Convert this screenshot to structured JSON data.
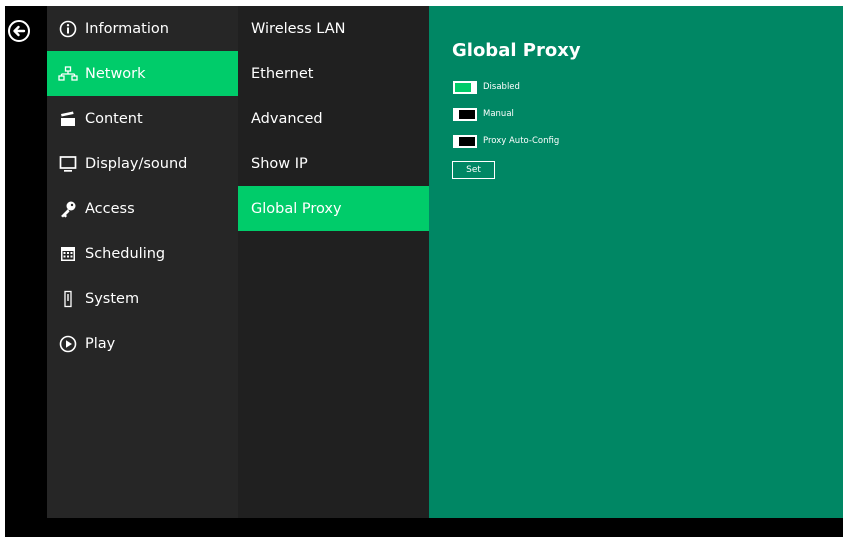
{
  "main_menu": {
    "items": [
      {
        "label": "Information",
        "icon": "info-icon"
      },
      {
        "label": "Network",
        "icon": "network-icon",
        "active": true
      },
      {
        "label": "Content",
        "icon": "clapperboard-icon"
      },
      {
        "label": "Display/sound",
        "icon": "monitor-icon"
      },
      {
        "label": "Access",
        "icon": "key-icon"
      },
      {
        "label": "Scheduling",
        "icon": "calendar-icon"
      },
      {
        "label": "System",
        "icon": "system-icon"
      },
      {
        "label": "Play",
        "icon": "play-icon"
      }
    ]
  },
  "network_menu": {
    "items": [
      {
        "label": "Wireless LAN"
      },
      {
        "label": "Ethernet"
      },
      {
        "label": "Advanced"
      },
      {
        "label": "Show IP"
      },
      {
        "label": "Global Proxy",
        "active": true
      }
    ]
  },
  "global_proxy": {
    "title": "Global Proxy",
    "options": [
      {
        "label": "Disabled",
        "on": true
      },
      {
        "label": "Manual",
        "on": false
      },
      {
        "label": "Proxy Auto-Config",
        "on": false
      }
    ],
    "set_label": "Set"
  },
  "colors": {
    "accent": "#00cc6a",
    "content_bg": "#008764",
    "menu_bg": "#262626",
    "submenu_bg": "#202020"
  },
  "icons": {
    "back": "back-arrow-icon"
  }
}
